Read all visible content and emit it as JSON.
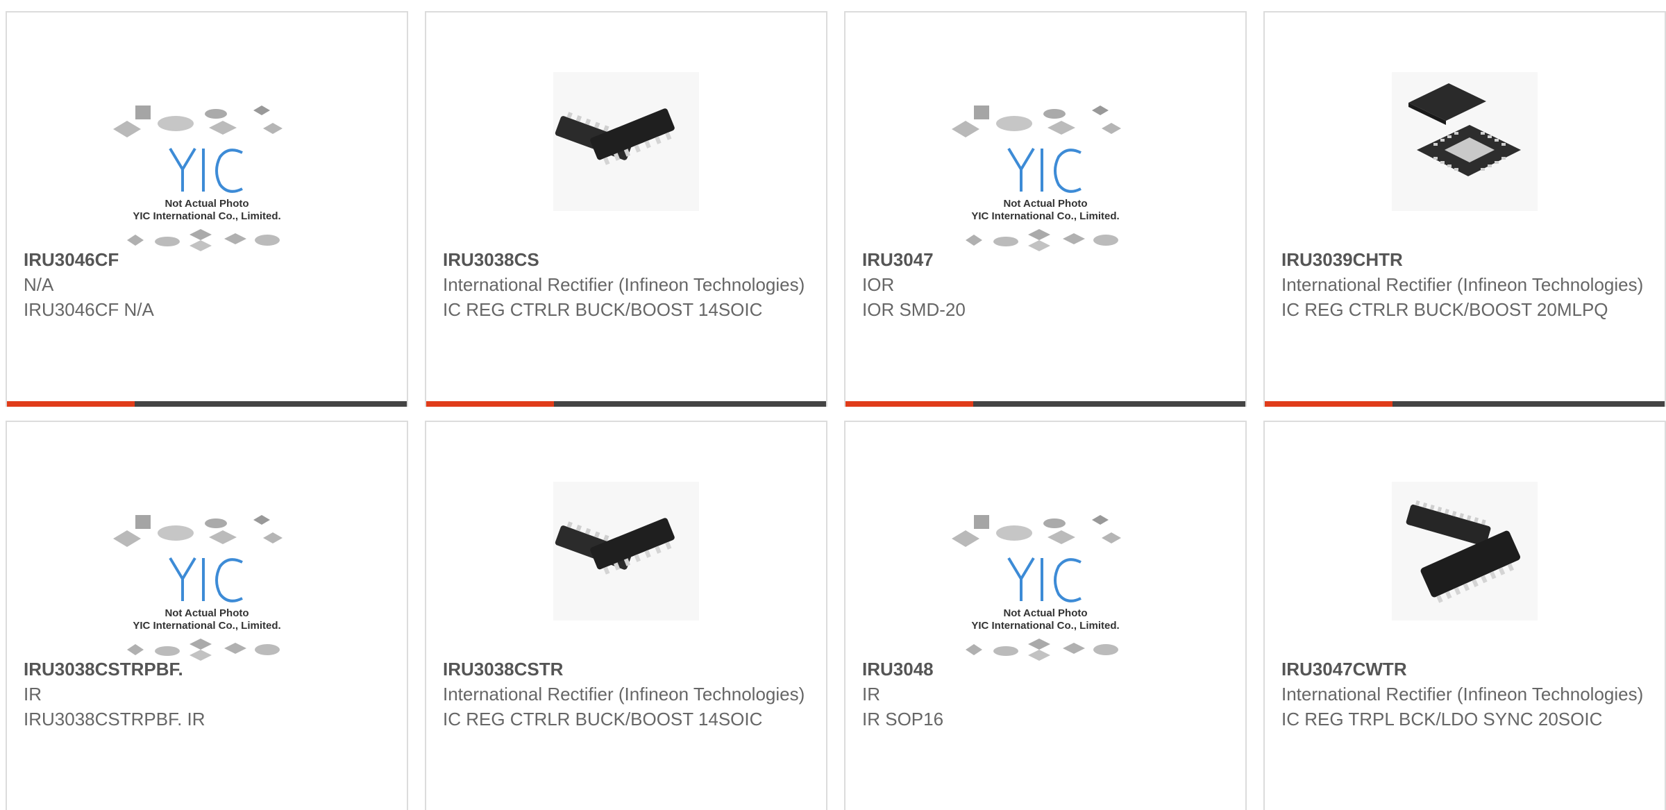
{
  "accent_color": "#e03c1a",
  "bar_color": "#444444",
  "products": [
    {
      "part_number": "IRU3046CF",
      "manufacturer": "N/A",
      "description": "IRU3046CF N/A",
      "image_type": "placeholder",
      "image_text_1": "Not Actual Photo",
      "image_text_2": "YIC International Co., Limited."
    },
    {
      "part_number": "IRU3038CS",
      "manufacturer": "International Rectifier (Infineon Technologies)",
      "description": "IC REG CTRLR BUCK/BOOST 14SOIC",
      "image_type": "soic-14"
    },
    {
      "part_number": "IRU3047",
      "manufacturer": "IOR",
      "description": "IOR SMD-20",
      "image_type": "placeholder",
      "image_text_1": "Not Actual Photo",
      "image_text_2": "YIC International Co., Limited."
    },
    {
      "part_number": "IRU3039CHTR",
      "manufacturer": "International Rectifier (Infineon Technologies)",
      "description": "IC REG CTRLR BUCK/BOOST 20MLPQ",
      "image_type": "mlpq-20"
    },
    {
      "part_number": "IRU3038CSTRPBF.",
      "manufacturer": "IR",
      "description": "IRU3038CSTRPBF. IR",
      "image_type": "placeholder",
      "image_text_1": "Not Actual Photo",
      "image_text_2": "YIC International Co., Limited."
    },
    {
      "part_number": "IRU3038CSTR",
      "manufacturer": "International Rectifier (Infineon Technologies)",
      "description": "IC REG CTRLR BUCK/BOOST 14SOIC",
      "image_type": "soic-14"
    },
    {
      "part_number": "IRU3048",
      "manufacturer": "IR",
      "description": "IR SOP16",
      "image_type": "placeholder",
      "image_text_1": "Not Actual Photo",
      "image_text_2": "YIC International Co., Limited."
    },
    {
      "part_number": "IRU3047CWTR",
      "manufacturer": "International Rectifier (Infineon Technologies)",
      "description": "IC REG TRPL BCK/LDO SYNC 20SOIC",
      "image_type": "soic-20"
    }
  ]
}
